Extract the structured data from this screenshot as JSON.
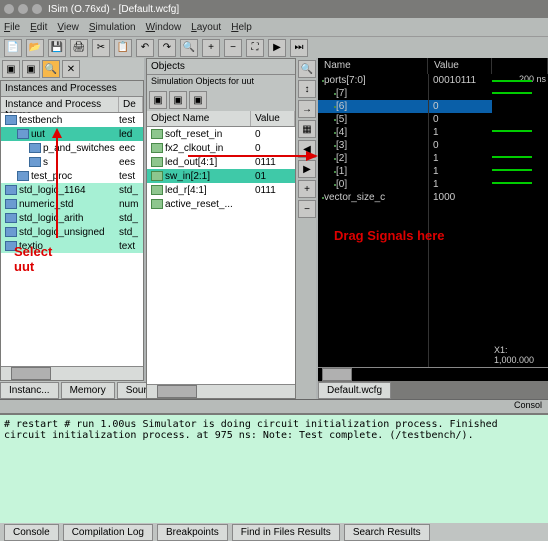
{
  "window": {
    "title": "ISim (O.76xd) - [Default.wcfg]"
  },
  "menu": [
    "File",
    "Edit",
    "View",
    "Simulation",
    "Window",
    "Layout",
    "Help"
  ],
  "panels": {
    "instances": {
      "title": "Instances and Processes",
      "colA": "Instance and Process Name",
      "colB": "De",
      "rows": [
        {
          "name": "testbench",
          "val": "test",
          "sel": false,
          "ind": 0
        },
        {
          "name": "uut",
          "val": "led",
          "sel": true,
          "ind": 1
        },
        {
          "name": "p_and_switches",
          "val": "eec",
          "sel": false,
          "ind": 2
        },
        {
          "name": "s",
          "val": "ees",
          "sel": false,
          "ind": 2
        },
        {
          "name": "test_proc",
          "val": "test",
          "sel": false,
          "ind": 1
        },
        {
          "name": "std_logic_1164",
          "val": "std_",
          "sel": false,
          "ind": 0,
          "alt": true
        },
        {
          "name": "numeric_std",
          "val": "num",
          "sel": false,
          "ind": 0,
          "alt": true
        },
        {
          "name": "std_logic_arith",
          "val": "std_",
          "sel": false,
          "ind": 0,
          "alt": true
        },
        {
          "name": "std_logic_unsigned",
          "val": "std_",
          "sel": false,
          "ind": 0,
          "alt": true
        },
        {
          "name": "textio",
          "val": "text",
          "sel": false,
          "ind": 0,
          "alt": true
        }
      ],
      "tabs": [
        "Instanc...",
        "Memory",
        "Sourc..."
      ]
    },
    "objects": {
      "title": "Objects",
      "subtitle": "Simulation Objects for uut",
      "colA": "Object Name",
      "colB": "Value",
      "rows": [
        {
          "name": "soft_reset_in",
          "val": "0"
        },
        {
          "name": "fx2_clkout_in",
          "val": "0"
        },
        {
          "name": "led_out[4:1]",
          "val": "0111"
        },
        {
          "name": "sw_in[2:1]",
          "val": "01",
          "sel": true
        },
        {
          "name": "led_r[4:1]",
          "val": "0111"
        },
        {
          "name": "active_reset_...",
          "val": ""
        }
      ]
    },
    "wave": {
      "nameCol": "Name",
      "valCol": "Value",
      "timeLabel": "200 ns",
      "cursor": "X1: 1,000.000",
      "rows": [
        {
          "name": "ports[7:0]",
          "val": "00010111",
          "ind": 0
        },
        {
          "name": "[7]",
          "val": "",
          "ind": 1
        },
        {
          "name": "[6]",
          "val": "0",
          "ind": 1,
          "sel": true
        },
        {
          "name": "[5]",
          "val": "0",
          "ind": 1
        },
        {
          "name": "[4]",
          "val": "1",
          "ind": 1
        },
        {
          "name": "[3]",
          "val": "0",
          "ind": 1
        },
        {
          "name": "[2]",
          "val": "1",
          "ind": 1
        },
        {
          "name": "[1]",
          "val": "1",
          "ind": 1
        },
        {
          "name": "[0]",
          "val": "1",
          "ind": 1
        },
        {
          "name": "vector_size_c",
          "val": "1000",
          "ind": 0
        }
      ],
      "tab": "Default.wcfg"
    }
  },
  "annotations": {
    "selectUut": "Select\nuut",
    "dragSignals": "Drag Signals here"
  },
  "console": {
    "header": "Consol",
    "lines": [
      "# restart",
      "",
      "# run 1.00us",
      "Simulator is doing circuit initialization process.",
      "Finished circuit initialization process.",
      "at 975 ns: Note: Test complete. (/testbench/).",
      ""
    ],
    "tabs": [
      "Console",
      "Compilation Log",
      "Breakpoints",
      "Find in Files Results",
      "Search Results"
    ]
  }
}
